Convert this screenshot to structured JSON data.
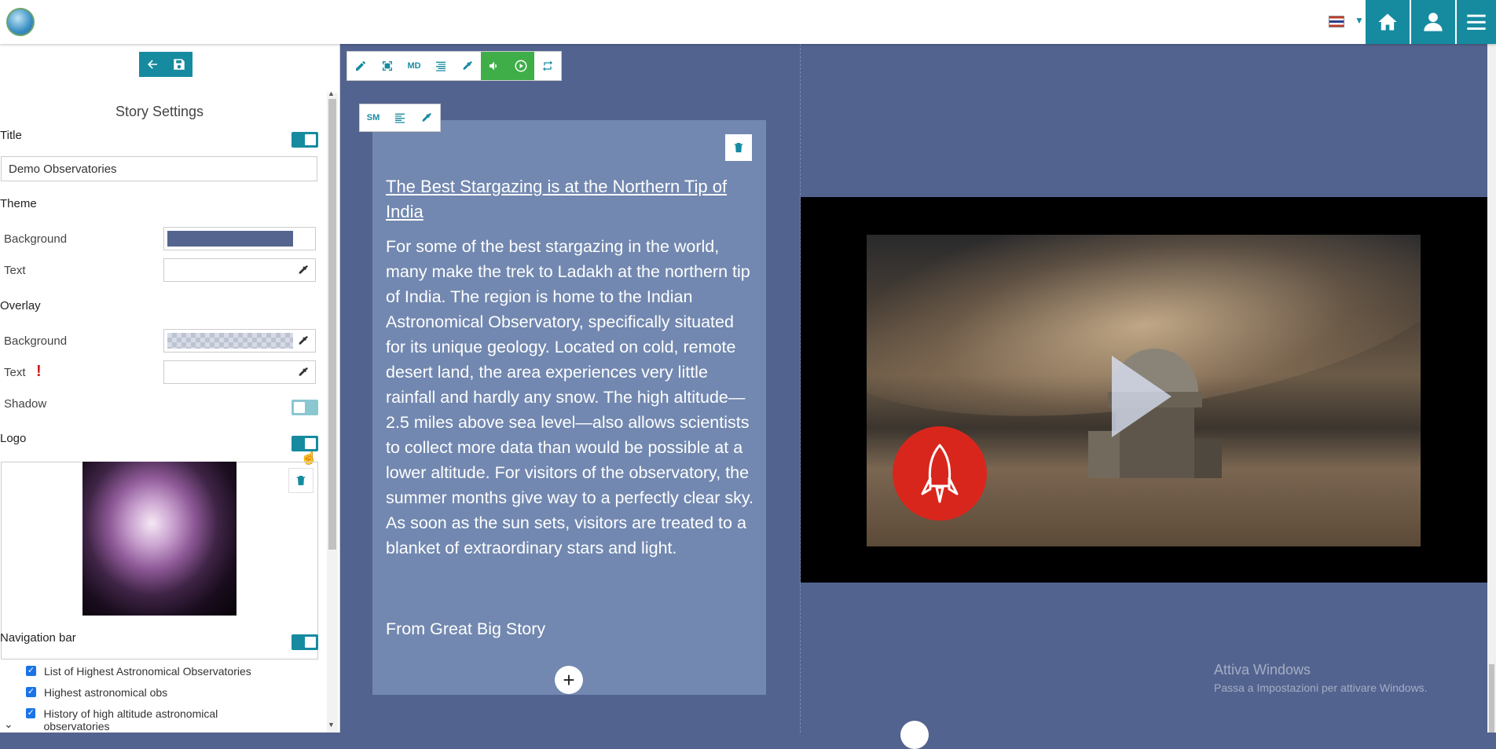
{
  "topbar": {
    "logo_icon": "globe-icon",
    "language_icon": "flag-uk-icon",
    "buttons": [
      "home-icon",
      "user-icon",
      "menu-icon"
    ]
  },
  "sidebar": {
    "tools": [
      "back-arrow-icon",
      "save-icon"
    ],
    "panel_title": "Story Settings",
    "title_label": "Title",
    "title_value": "Demo Observatories",
    "theme_label": "Theme",
    "theme_background_label": "Background",
    "theme_background_color": "#55648f",
    "theme_text_label": "Text",
    "overlay_label": "Overlay",
    "overlay_background_label": "Background",
    "overlay_text_label": "Text",
    "overlay_text_warning": "!",
    "shadow_label": "Shadow",
    "logo_label": "Logo",
    "navbar_label": "Navigation bar",
    "nav_items": [
      "List of Highest Astronomical Observatories",
      "Highest astronomical obs",
      "History of high altitude astronomical observatories"
    ]
  },
  "canvas": {
    "toolbar": [
      "edit-icon",
      "fullscreen-icon",
      "MD",
      "align-icon",
      "eyedropper-icon",
      "volume-icon",
      "play-circle-icon",
      "repeat-icon"
    ],
    "text_toolbar": [
      "SM",
      "align-left-icon",
      "eyedropper-icon"
    ],
    "card": {
      "title": "The Best Stargazing is at the Northern Tip of India",
      "body": "For some of the best stargazing in the world, many make the trek to Ladakh at the northern tip of India. The region is home to the Indian Astronomical Observatory, specifically situated for its unique geology. Located on cold, remote desert land, the area experiences very little rainfall and hardly any snow. The high altitude—2.5 miles above sea level—also allows scientists to collect more data than would be possible at a lower altitude. For visitors of the observatory, the summer months give way to a perfectly clear sky. As soon as the sun sets, visitors are treated to a blanket of extraordinary stars and light.",
      "source": "From Great Big Story"
    },
    "add_symbol": "+"
  },
  "watermark": {
    "line1": "Attiva Windows",
    "line2": "Passa a Impostazioni per attivare Windows."
  },
  "colors": {
    "accent": "#168ba0",
    "green": "#3fae49",
    "canvas_bg": "#55648f",
    "card_bg": "#7288b0",
    "rocket_red": "#d9261c"
  }
}
